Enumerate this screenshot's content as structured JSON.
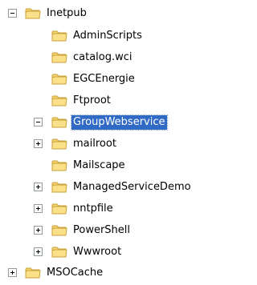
{
  "tree": {
    "root": {
      "label": "Inetpub",
      "expanded": true,
      "expander_icon": "minus-box-icon"
    },
    "children": [
      {
        "label": "AdminScripts",
        "expander": "none"
      },
      {
        "label": "catalog.wci",
        "expander": "none"
      },
      {
        "label": "EGCEnergie",
        "expander": "none"
      },
      {
        "label": "Ftproot",
        "expander": "none"
      },
      {
        "label": "GroupWebservice",
        "expander": "minus",
        "selected": true
      },
      {
        "label": "mailroot",
        "expander": "plus"
      },
      {
        "label": "Mailscape",
        "expander": "none"
      },
      {
        "label": "ManagedServiceDemo",
        "expander": "plus"
      },
      {
        "label": "nntpfile",
        "expander": "plus"
      },
      {
        "label": "PowerShell",
        "expander": "plus"
      },
      {
        "label": "Wwwroot",
        "expander": "plus"
      }
    ],
    "sibling": {
      "label": "MSOCache",
      "expander": "plus"
    }
  },
  "colors": {
    "selection_bg": "#316ac5",
    "selection_text": "#ffffff",
    "folder_yellow": "#f7d46b",
    "folder_outline": "#c8a23b",
    "expander_border": "#919b9c"
  },
  "icons": {
    "folder": "folder-icon",
    "expand": "plus-box-icon",
    "collapse": "minus-box-icon"
  }
}
